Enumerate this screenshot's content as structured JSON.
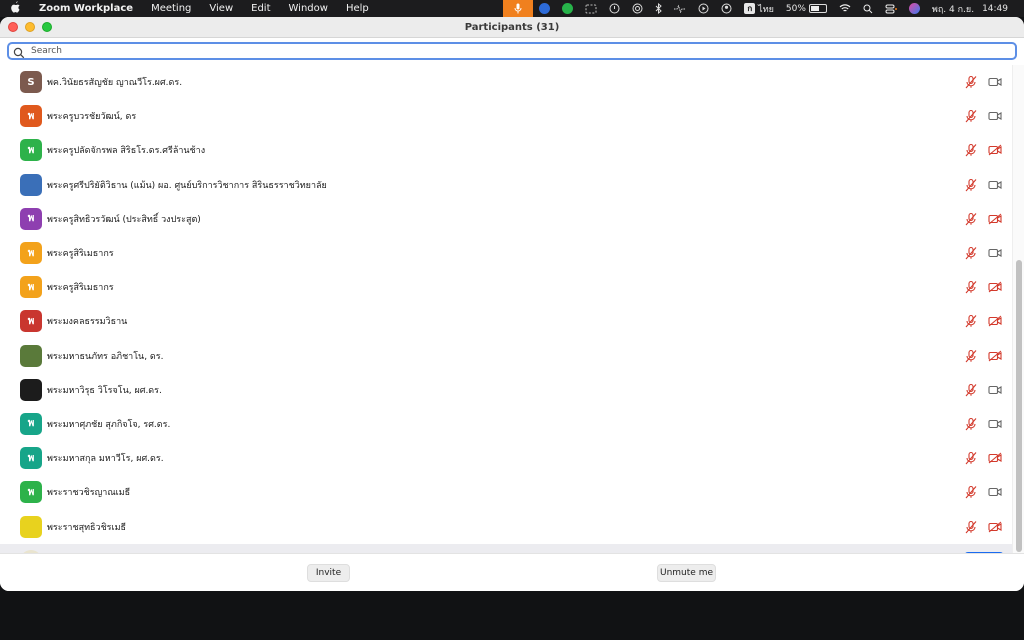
{
  "menubar": {
    "app_name": "Zoom Workplace",
    "menus": [
      "Meeting",
      "View",
      "Edit",
      "Window",
      "Help"
    ],
    "input_source": "ก",
    "language": "ไทย",
    "battery": "50%",
    "datetime_date": "พฤ. 4 ก.ย.",
    "datetime_time": "14:49"
  },
  "window": {
    "title": "Participants (31)"
  },
  "search": {
    "placeholder": "Search"
  },
  "participants": [
    {
      "name": "พค.วินัยธรสัญชัย ญาณวีโร.ผศ.ดร.",
      "avatar_letter": "S",
      "avatar_color": "#7c5a4e",
      "mic": "muted",
      "video": "on"
    },
    {
      "name": "พระครูบวรชัยวัฒน์, ดร",
      "avatar_letter": "พ",
      "avatar_color": "#e0591d",
      "mic": "muted",
      "video": "on"
    },
    {
      "name": "พระครูปลัดจักรพล สิริธโร.ดร.ศรีล้านช้าง",
      "avatar_letter": "พ",
      "avatar_color": "#2db24a",
      "mic": "muted",
      "video": "off"
    },
    {
      "name": "พระครูศรีปริยัติวิธาน (แม้น) ผอ. ศูนย์บริการวิชาการ สิรินธรราชวิทยาลัย",
      "avatar_letter": "",
      "avatar_color": "#3a6fb8",
      "mic": "muted",
      "video": "on"
    },
    {
      "name": "พระครูสิทธิวรวัฒน์ (ประสิทธิ์ วงประสูต)",
      "avatar_letter": "พ",
      "avatar_color": "#8e3fb0",
      "mic": "muted",
      "video": "off"
    },
    {
      "name": "พระครูสิริเมธากร",
      "avatar_letter": "พ",
      "avatar_color": "#f3a21b",
      "mic": "muted",
      "video": "on"
    },
    {
      "name": "พระครูสิริเมธากร",
      "avatar_letter": "พ",
      "avatar_color": "#f3a21b",
      "mic": "muted",
      "video": "off"
    },
    {
      "name": "พระมงคลธรรมวิธาน",
      "avatar_letter": "พ",
      "avatar_color": "#c9362f",
      "mic": "muted",
      "video": "off"
    },
    {
      "name": "พระมหาธนภัทร อภิชาโน, ดร.",
      "avatar_letter": "",
      "avatar_color": "#5a7a3a",
      "mic": "muted",
      "video": "off"
    },
    {
      "name": "พระมหาวิรุธ วิโรจโน, ผศ.ดร.",
      "avatar_letter": "",
      "avatar_color": "#1c1c1c",
      "mic": "muted",
      "video": "on"
    },
    {
      "name": "พระมหาศุภชัย สุภกิจโจ, รศ.ดร.",
      "avatar_letter": "พ",
      "avatar_color": "#17a589",
      "mic": "muted",
      "video": "on"
    },
    {
      "name": "พระมหาสกุล มหาวีโร, ผศ.ดร.",
      "avatar_letter": "พ",
      "avatar_color": "#17a589",
      "mic": "muted",
      "video": "off"
    },
    {
      "name": "พระราชวชิรญาณเมธี",
      "avatar_letter": "พ",
      "avatar_color": "#2db24a",
      "mic": "muted",
      "video": "on"
    },
    {
      "name": "พระราชสุทธิวชิรเมธี",
      "avatar_letter": "",
      "avatar_color": "#e8d21e",
      "mic": "muted",
      "video": "off"
    },
    {
      "name": "",
      "avatar_letter": "",
      "avatar_color": "#e9e4cf",
      "mic": "",
      "video": ""
    }
  ],
  "footer": {
    "invite_label": "Invite",
    "unmute_label": "Unmute me"
  },
  "colors": {
    "search_focus": "#5d8fe6",
    "muted_icon": "#d33a2c",
    "primary_button": "#1a6bf0"
  }
}
